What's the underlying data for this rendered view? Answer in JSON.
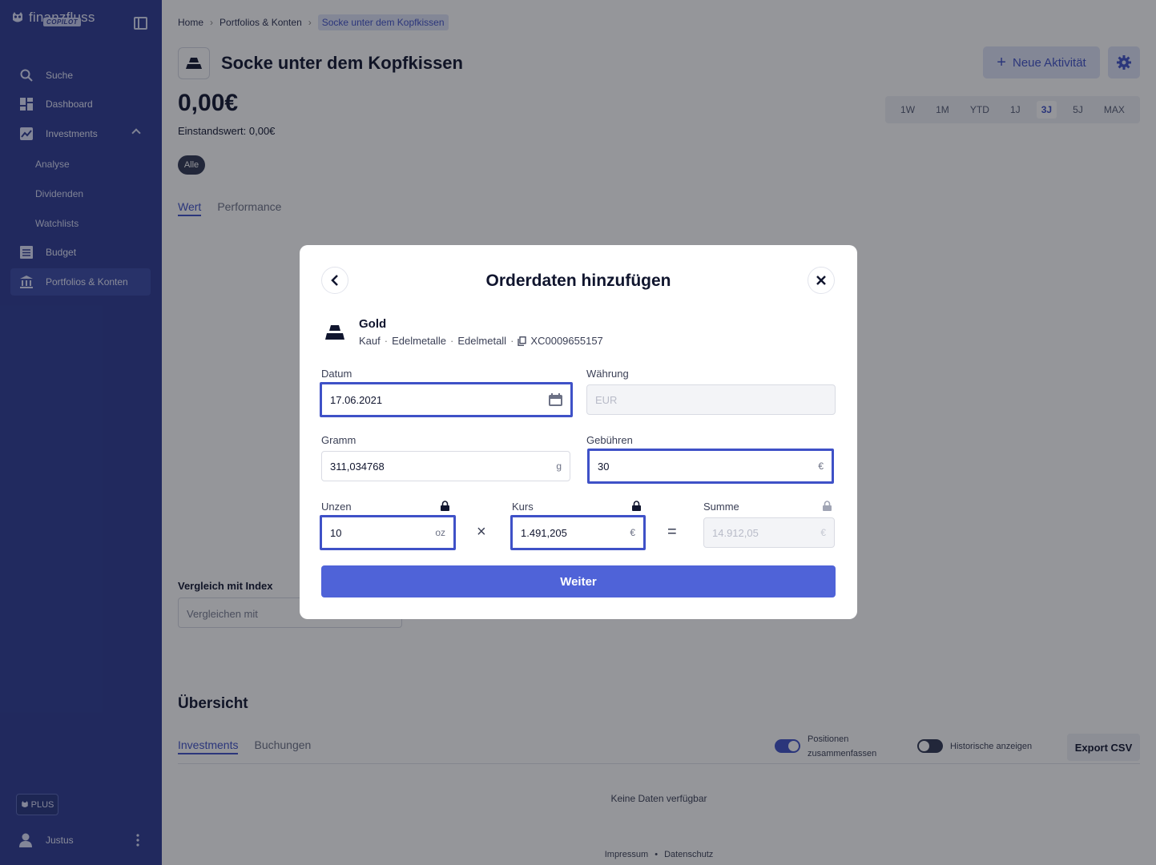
{
  "sidebar": {
    "logo_text": "finanzfluss",
    "logo_badge": "COPILOT",
    "items": [
      {
        "label": "Suche"
      },
      {
        "label": "Dashboard"
      },
      {
        "label": "Investments"
      },
      {
        "label": "Budget"
      },
      {
        "label": "Portfolios & Konten"
      }
    ],
    "sub_items": [
      {
        "label": "Analyse"
      },
      {
        "label": "Dividenden"
      },
      {
        "label": "Watchlists"
      }
    ],
    "plus_label": "PLUS",
    "user_name": "Justus"
  },
  "breadcrumb": [
    "Home",
    "Portfolios & Konten",
    "Socke unter dem Kopfkissen"
  ],
  "header": {
    "title": "Socke unter dem Kopfkissen",
    "new_activity_label": "Neue Aktivität"
  },
  "summary": {
    "value": "0,00€",
    "einstandswert": "Einstandswert: 0,00€"
  },
  "ranges": [
    "1W",
    "1M",
    "YTD",
    "1J",
    "3J",
    "5J",
    "MAX"
  ],
  "selected_range": "3J",
  "filter_pill": "Alle",
  "chart_tabs": [
    "Wert",
    "Performance"
  ],
  "compare": {
    "label": "Vergleich mit Index",
    "placeholder": "Vergleichen mit"
  },
  "overview": {
    "title": "Übersicht",
    "tabs": [
      "Investments",
      "Buchungen"
    ],
    "toggle_positions_label_1": "Positionen",
    "toggle_positions_label_2": "zusammenfassen",
    "toggle_history_label": "Historische anzeigen",
    "export_label": "Export CSV",
    "empty_text": "Keine Daten verfügbar"
  },
  "footer": {
    "impressum": "Impressum",
    "sep": "•",
    "datenschutz": "Datenschutz"
  },
  "modal": {
    "title": "Orderdaten hinzufügen",
    "asset": {
      "name": "Gold",
      "type": "Kauf",
      "category": "Edelmetalle",
      "subcategory": "Edelmetall",
      "isin": "XC0009655157"
    },
    "fields": {
      "datum_label": "Datum",
      "datum_value": "17.06.2021",
      "waehrung_label": "Währung",
      "waehrung_value": "EUR",
      "gramm_label": "Gramm",
      "gramm_value": "311,034768",
      "gramm_unit": "g",
      "gebuehren_label": "Gebühren",
      "gebuehren_value": "30",
      "gebuehren_unit": "€",
      "unzen_label": "Unzen",
      "unzen_value": "10",
      "unzen_unit": "oz",
      "kurs_label": "Kurs",
      "kurs_value": "1.491,205",
      "kurs_unit": "€",
      "summe_label": "Summe",
      "summe_value": "14.912,05",
      "summe_unit": "€"
    },
    "op_times": "×",
    "op_equals": "=",
    "submit_label": "Weiter"
  },
  "colors": {
    "sidebar_bg": "#2c3a93",
    "accent": "#3f51c7",
    "button_primary": "#4f63d8"
  }
}
